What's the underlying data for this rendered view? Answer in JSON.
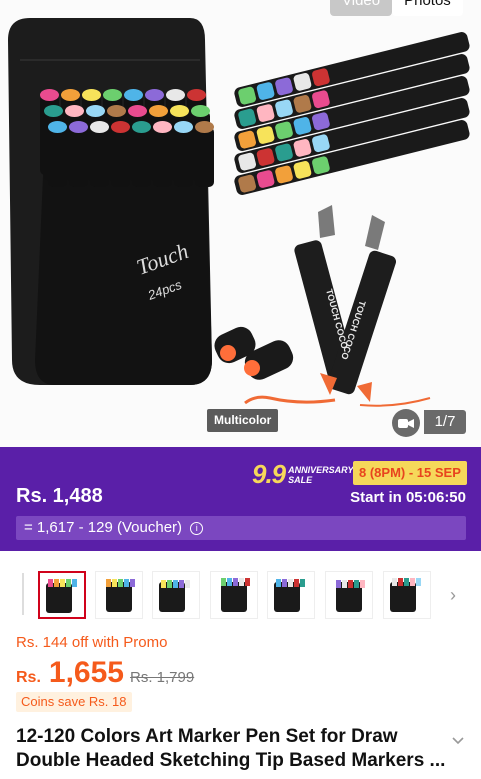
{
  "gallery": {
    "tabs": [
      "Video",
      "Photos"
    ],
    "case_text": "Touch",
    "case_subtext": "24pcs",
    "marker_brand": "TOUCH COCO",
    "badge": "Multicolor",
    "counter": "1/7",
    "video_icon": "video-camera-icon"
  },
  "promo": {
    "price": "Rs. 1,488",
    "sale_number": "9.9",
    "sale_text_1": "ANNIVERSARY",
    "sale_text_2": "SALE",
    "dates": "8 (8PM) - 15 SEP",
    "start": "Start in 05:06:50",
    "voucher": "= 1,617 - 129 (Voucher)",
    "info_icon": "info-icon",
    "colors": {
      "band": "#5a1fa8",
      "pill": "#f6d85a",
      "accent": "#e8441e"
    }
  },
  "thumbnails": {
    "count": 7,
    "active_index": 0,
    "next_icon": "chevron-right-icon"
  },
  "pricing": {
    "promo_off": "Rs. 144 off with Promo",
    "currency": "Rs.",
    "amount": "1,655",
    "original": "Rs. 1,799",
    "coins": "Coins save Rs. 18",
    "accent_color": "#f55a1b"
  },
  "product": {
    "title": "12-120 Colors Art Marker Pen Set for Draw Double Headed Sketching Tip Based Markers ...",
    "expand_icon": "chevron-down-icon"
  }
}
